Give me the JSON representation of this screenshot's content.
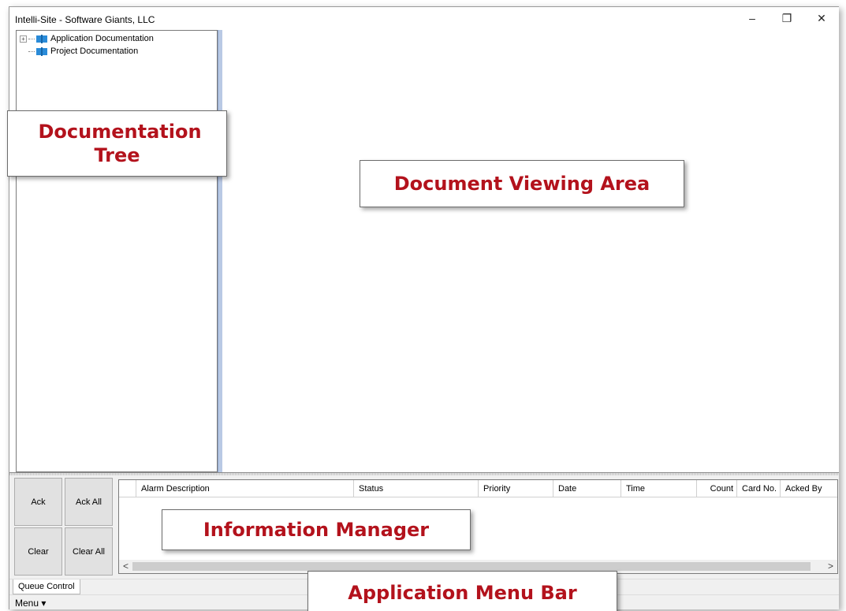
{
  "window": {
    "title": "Intelli-Site - Software Giants, LLC",
    "minimize_glyph": "–",
    "maximize_glyph": "❐",
    "close_glyph": "✕"
  },
  "tree": {
    "items": [
      {
        "label": "Application Documentation",
        "expander": "+",
        "icon": "book-icon"
      },
      {
        "label": "Project Documentation",
        "icon": "book-icon"
      }
    ]
  },
  "info_manager": {
    "buttons": {
      "ack": "Ack",
      "ack_all": "Ack All",
      "clear": "Clear",
      "clear_all": "Clear All"
    },
    "columns": [
      "Alarm Description",
      "Status",
      "Priority",
      "Date",
      "Time",
      "Count",
      "Card No.",
      "Acked By"
    ],
    "scroll_left": "<",
    "scroll_right": ">"
  },
  "tabs": {
    "queue_control": "Queue Control"
  },
  "menubar": {
    "menu_label": "Menu ▾"
  },
  "callouts": {
    "documentation_tree": "Documentation Tree",
    "document_viewing_area": "Document Viewing Area",
    "information_manager": "Information Manager",
    "application_menu_bar": "Application Menu Bar"
  },
  "colors": {
    "callout_text": "#b3121c",
    "splitter": "#b9c9e4"
  }
}
